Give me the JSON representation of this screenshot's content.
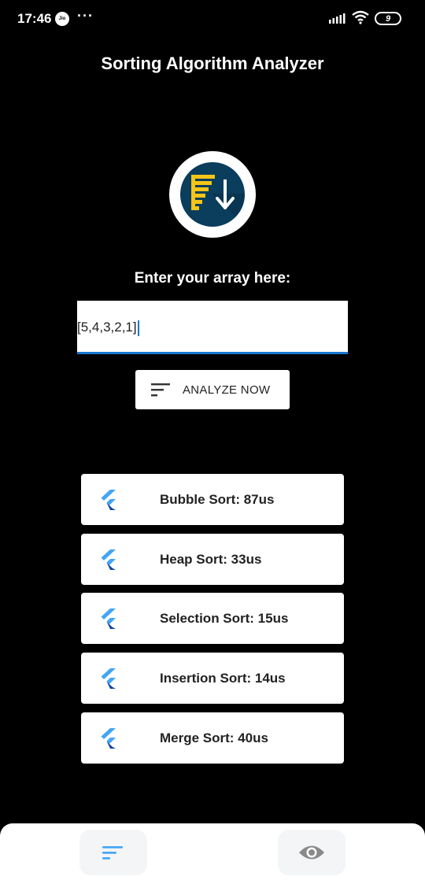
{
  "status_bar": {
    "time": "17:46",
    "carrier_badge": "Jio",
    "notification_dots": "···",
    "battery_level": "9"
  },
  "app": {
    "title": "Sorting Algorithm Analyzer",
    "logo": "sort-descending-logo"
  },
  "input": {
    "label": "Enter your array here:",
    "value": "[5,4,3,2,1]"
  },
  "analyze_button": {
    "label": "ANALYZE NOW",
    "icon": "sort-icon"
  },
  "results": [
    {
      "label": "Bubble Sort: 87us",
      "icon": "flutter-icon"
    },
    {
      "label": "Heap Sort: 33us",
      "icon": "flutter-icon"
    },
    {
      "label": "Selection Sort: 15us",
      "icon": "flutter-icon"
    },
    {
      "label": "Insertion Sort: 14us",
      "icon": "flutter-icon"
    },
    {
      "label": "Merge Sort: 40us",
      "icon": "flutter-icon"
    }
  ],
  "bottom_nav": {
    "items": [
      {
        "icon": "sort-icon",
        "active": true
      },
      {
        "icon": "eye-icon",
        "active": false
      }
    ]
  },
  "colors": {
    "background": "#000000",
    "accent": "#1976d2",
    "logo_bg": "#0b3d5c",
    "logo_bars": "#f5c518",
    "flutter_light": "#42a5f5",
    "flutter_dark": "#0d47a1"
  }
}
